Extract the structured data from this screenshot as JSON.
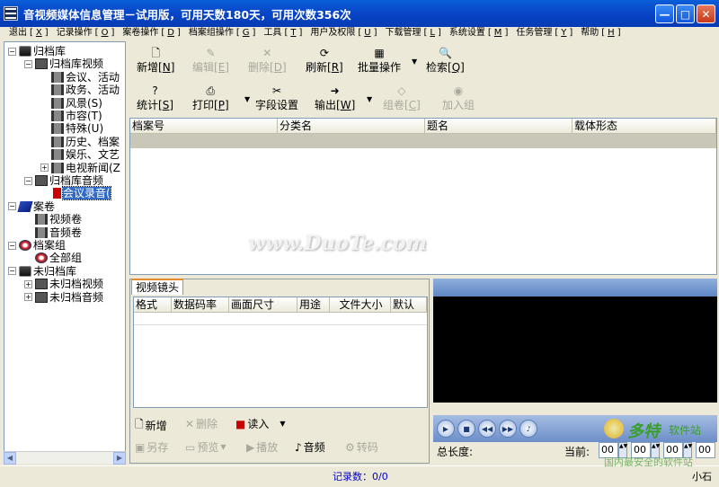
{
  "window": {
    "title": "音视频媒体信息管理－试用版，可用天数180天，可用次数356次",
    "min": "—",
    "max": "□",
    "close": "✕"
  },
  "menu": [
    {
      "label": "退出",
      "key": "X"
    },
    {
      "label": "记录操作",
      "key": "O"
    },
    {
      "label": "案卷操作",
      "key": "D"
    },
    {
      "label": "档案组操作",
      "key": "G"
    },
    {
      "label": "工具",
      "key": "T"
    },
    {
      "label": "用户及权限",
      "key": "U"
    },
    {
      "label": "下载管理",
      "key": "L"
    },
    {
      "label": "系统设置",
      "key": "M"
    },
    {
      "label": "任务管理",
      "key": "Y"
    },
    {
      "label": "帮助",
      "key": "H"
    }
  ],
  "tree": [
    {
      "label": "归档库",
      "level": 0,
      "exp": "−",
      "icon": "rec"
    },
    {
      "label": "归档库视频",
      "level": 1,
      "exp": "−",
      "icon": "film"
    },
    {
      "label": "会议、活动",
      "level": 2,
      "icon": "film2"
    },
    {
      "label": "政务、活动",
      "level": 2,
      "icon": "film2"
    },
    {
      "label": "风景(S)",
      "level": 2,
      "icon": "film2"
    },
    {
      "label": "市容(T)",
      "level": 2,
      "icon": "film2"
    },
    {
      "label": "特殊(U)",
      "level": 2,
      "icon": "film2"
    },
    {
      "label": "历史、档案",
      "level": 2,
      "icon": "film2"
    },
    {
      "label": "娱乐、文艺",
      "level": 2,
      "icon": "film2"
    },
    {
      "label": "电视新闻(Z",
      "level": 2,
      "exp": "+",
      "icon": "film2"
    },
    {
      "label": "归档库音频",
      "level": 1,
      "exp": "−",
      "icon": "film"
    },
    {
      "label": "会议录音(",
      "level": 2,
      "icon": "red",
      "sel": true
    },
    {
      "label": "案卷",
      "level": 0,
      "exp": "−",
      "icon": "book"
    },
    {
      "label": "视频卷",
      "level": 1,
      "icon": "film2"
    },
    {
      "label": "音频卷",
      "level": 1,
      "icon": "film2"
    },
    {
      "label": "档案组",
      "level": 0,
      "exp": "−",
      "icon": "globe"
    },
    {
      "label": "全部组",
      "level": 1,
      "icon": "globe"
    },
    {
      "label": "未归档库",
      "level": 0,
      "exp": "−",
      "icon": "rec"
    },
    {
      "label": "未归档视频",
      "level": 1,
      "exp": "+",
      "icon": "film"
    },
    {
      "label": "未归档音频",
      "level": 1,
      "exp": "+",
      "icon": "film"
    }
  ],
  "toolbar": {
    "row1": [
      {
        "label": "新增",
        "key": "N",
        "glyph": "🗋"
      },
      {
        "label": "编辑",
        "key": "E",
        "glyph": "✎",
        "dis": true
      },
      {
        "label": "删除",
        "key": "D",
        "glyph": "✕",
        "dis": true
      },
      {
        "label": "刷新",
        "key": "R",
        "glyph": "⟳"
      },
      {
        "label": "批量操作",
        "glyph": "▦"
      },
      {
        "label": "检索",
        "key": "Q",
        "glyph": "🔍"
      }
    ],
    "row2": [
      {
        "label": "统计",
        "key": "S",
        "glyph": "?"
      },
      {
        "label": "打印",
        "key": "P",
        "glyph": "⎙"
      },
      {
        "label": "字段设置",
        "glyph": "✂"
      },
      {
        "label": "输出",
        "key": "W",
        "glyph": "➜"
      },
      {
        "label": "组卷",
        "key": "C",
        "glyph": "◇",
        "dis": true
      },
      {
        "label": "加入组",
        "glyph": "◉",
        "dis": true
      }
    ]
  },
  "grid": {
    "columns": [
      "档案号",
      "分类名",
      "题名",
      "载体形态"
    ]
  },
  "watermark": "www.DuoTe.com",
  "tab": "视频镜头",
  "subgrid": {
    "columns": [
      "格式",
      "数据码率",
      "画面尺寸",
      "用途",
      "文件大小",
      "默认"
    ]
  },
  "subbtns": {
    "add": "新增",
    "del": "删除",
    "read": "读入",
    "saveas": "另存",
    "preview": "预览",
    "play": "播放",
    "audio": "音频",
    "transcode": "转码"
  },
  "player": {
    "duration_label": "总长度:",
    "current_label": "当前:",
    "time": [
      "00",
      "00",
      "00",
      "00"
    ]
  },
  "status": {
    "records": "记录数：0/0",
    "right": "小石"
  },
  "logo": {
    "brand": "多特",
    "sub": "软件站",
    "tagline": "国内最安全的软件站"
  }
}
